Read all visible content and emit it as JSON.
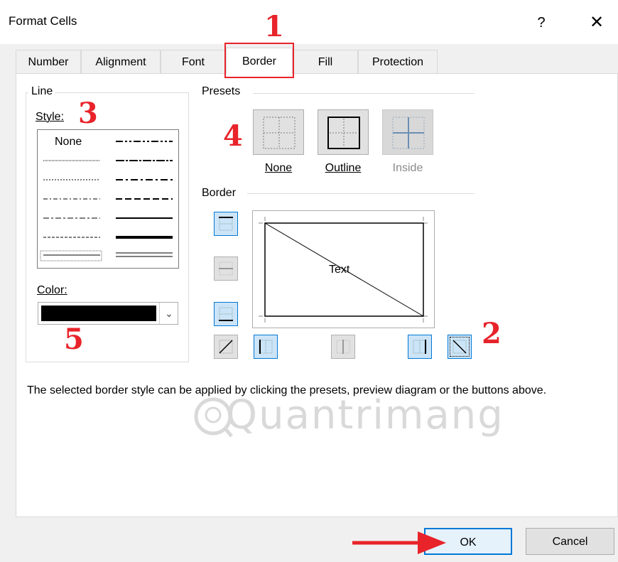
{
  "window": {
    "title": "Format Cells",
    "help": "?",
    "close": "✕"
  },
  "tabs": [
    "Number",
    "Alignment",
    "Font",
    "Border",
    "Fill",
    "Protection"
  ],
  "line": {
    "group_label": "Line",
    "style_label": "Style:",
    "none_label": "None",
    "color_label": "Color:",
    "color_value": "#000000"
  },
  "presets": {
    "group_label": "Presets",
    "items": [
      "None",
      "Outline",
      "Inside"
    ]
  },
  "border": {
    "group_label": "Border",
    "preview_text": "Text"
  },
  "description": "The selected border style can be applied by clicking the presets, preview diagram or the buttons above.",
  "watermark": "Quantrimang",
  "buttons": {
    "ok": "OK",
    "cancel": "Cancel"
  },
  "annotations": [
    "1",
    "2",
    "3",
    "4",
    "5"
  ],
  "colors": {
    "annotation": "#e8232a",
    "focus": "#0078d7"
  }
}
